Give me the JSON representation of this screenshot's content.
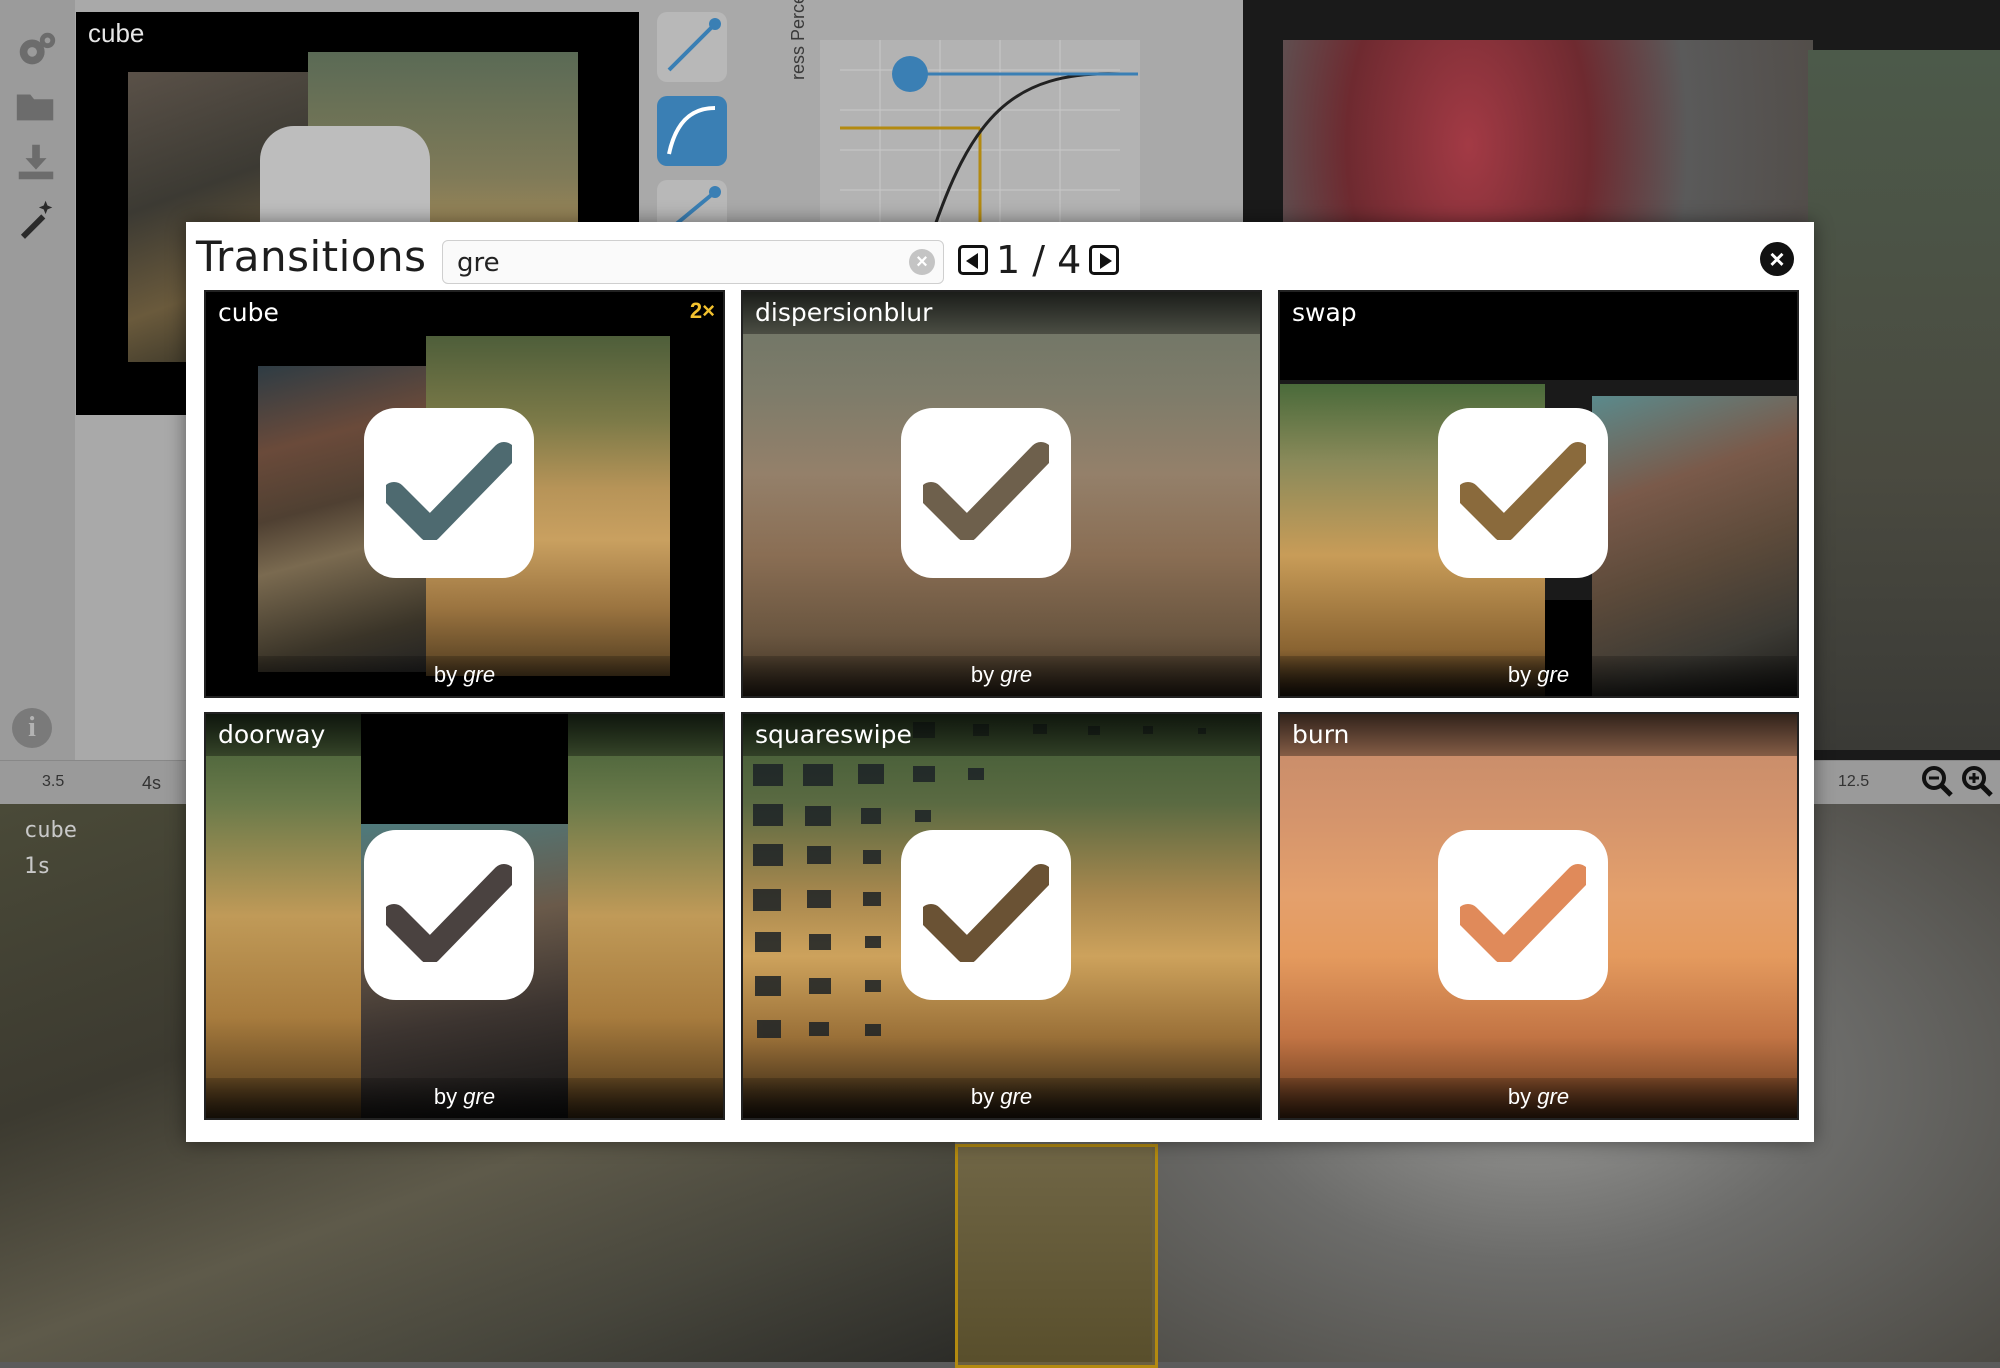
{
  "background": {
    "toolbar_icons": [
      "gear-icon",
      "folder-icon",
      "download-icon",
      "magic-wand-icon"
    ],
    "preview_title": "cube",
    "curve_axis_label": "ress Percentage",
    "ruler_ticks": [
      "3.5",
      "4s",
      "12.5"
    ],
    "track_label_name": "cube",
    "track_label_duration": "1s"
  },
  "modal": {
    "title": "Transitions",
    "search": {
      "value": "gre",
      "placeholder": ""
    },
    "pager": {
      "current": "1",
      "separator": "/",
      "total": "4",
      "text": "1 / 4"
    },
    "close_icon": "close-icon"
  },
  "transitions": [
    {
      "name": "cube",
      "badge": "2×",
      "by": "by",
      "author": "gre",
      "selected": true
    },
    {
      "name": "dispersionblur",
      "badge": "",
      "by": "by",
      "author": "gre",
      "selected": true
    },
    {
      "name": "swap",
      "badge": "",
      "by": "by",
      "author": "gre",
      "selected": true
    },
    {
      "name": "doorway",
      "badge": "",
      "by": "by",
      "author": "gre",
      "selected": true
    },
    {
      "name": "squareswipe",
      "badge": "",
      "by": "by",
      "author": "gre",
      "selected": true
    },
    {
      "name": "burn",
      "badge": "",
      "by": "by",
      "author": "gre",
      "selected": true
    }
  ],
  "colors": {
    "accent_blue": "#3a7fb4",
    "badge_yellow": "#f2c12e",
    "modal_bg": "#ffffff"
  }
}
